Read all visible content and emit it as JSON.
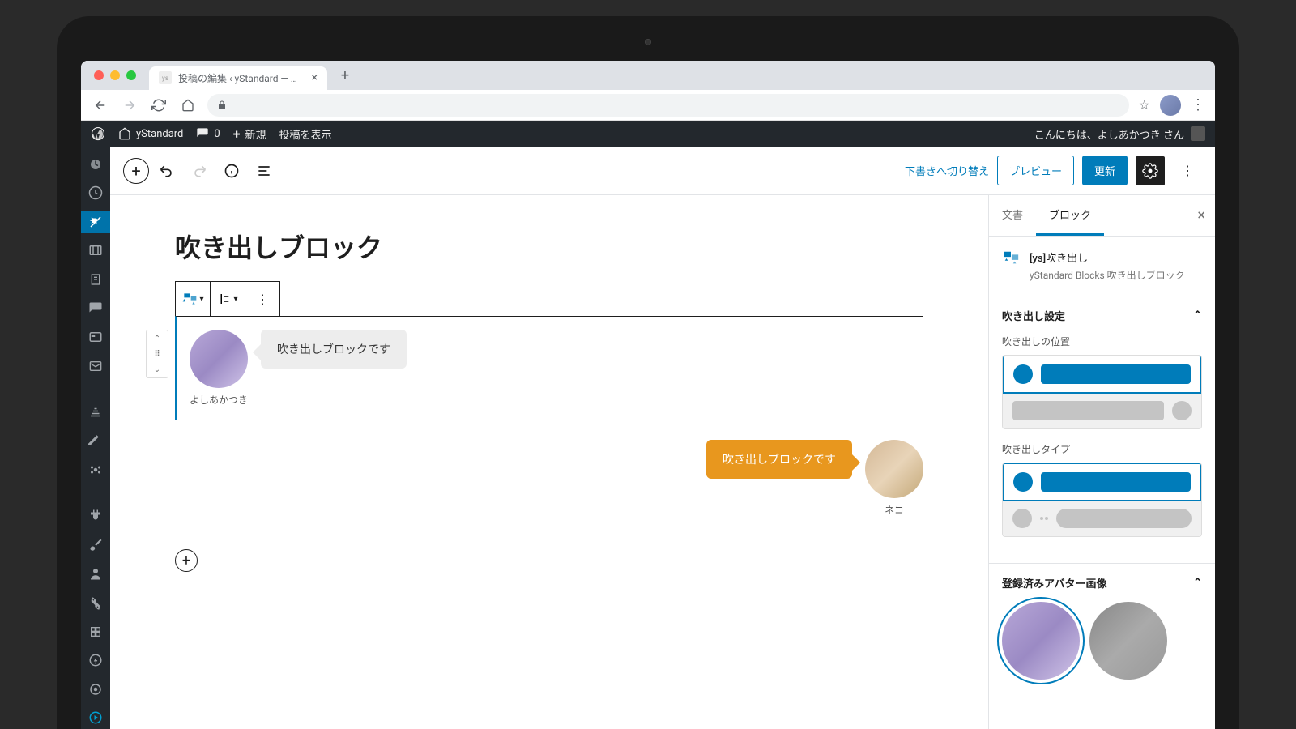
{
  "browser": {
    "tab_title": "投稿の編集 ‹ yStandard — WordP…"
  },
  "adminbar": {
    "site_name": "yStandard",
    "comments_count": "0",
    "new_label": "新規",
    "view_post": "投稿を表示",
    "greeting": "こんにちは、よしあかつき さん"
  },
  "editor_toolbar": {
    "switch_draft": "下書きへ切り替え",
    "preview": "プレビュー",
    "update": "更新"
  },
  "post": {
    "title": "吹き出しブロック",
    "balloon1_text": "吹き出しブロックです",
    "balloon1_name": "よしあかつき",
    "balloon2_text": "吹き出しブロックです",
    "balloon2_name": "ネコ"
  },
  "sidebar": {
    "tab_document": "文書",
    "tab_block": "ブロック",
    "block_title": "[ys]吹き出し",
    "block_desc": "yStandard Blocks 吹き出しブロック",
    "panel_settings": "吹き出し設定",
    "label_position": "吹き出しの位置",
    "label_type": "吹き出しタイプ",
    "panel_avatars": "登録済みアバター画像"
  }
}
